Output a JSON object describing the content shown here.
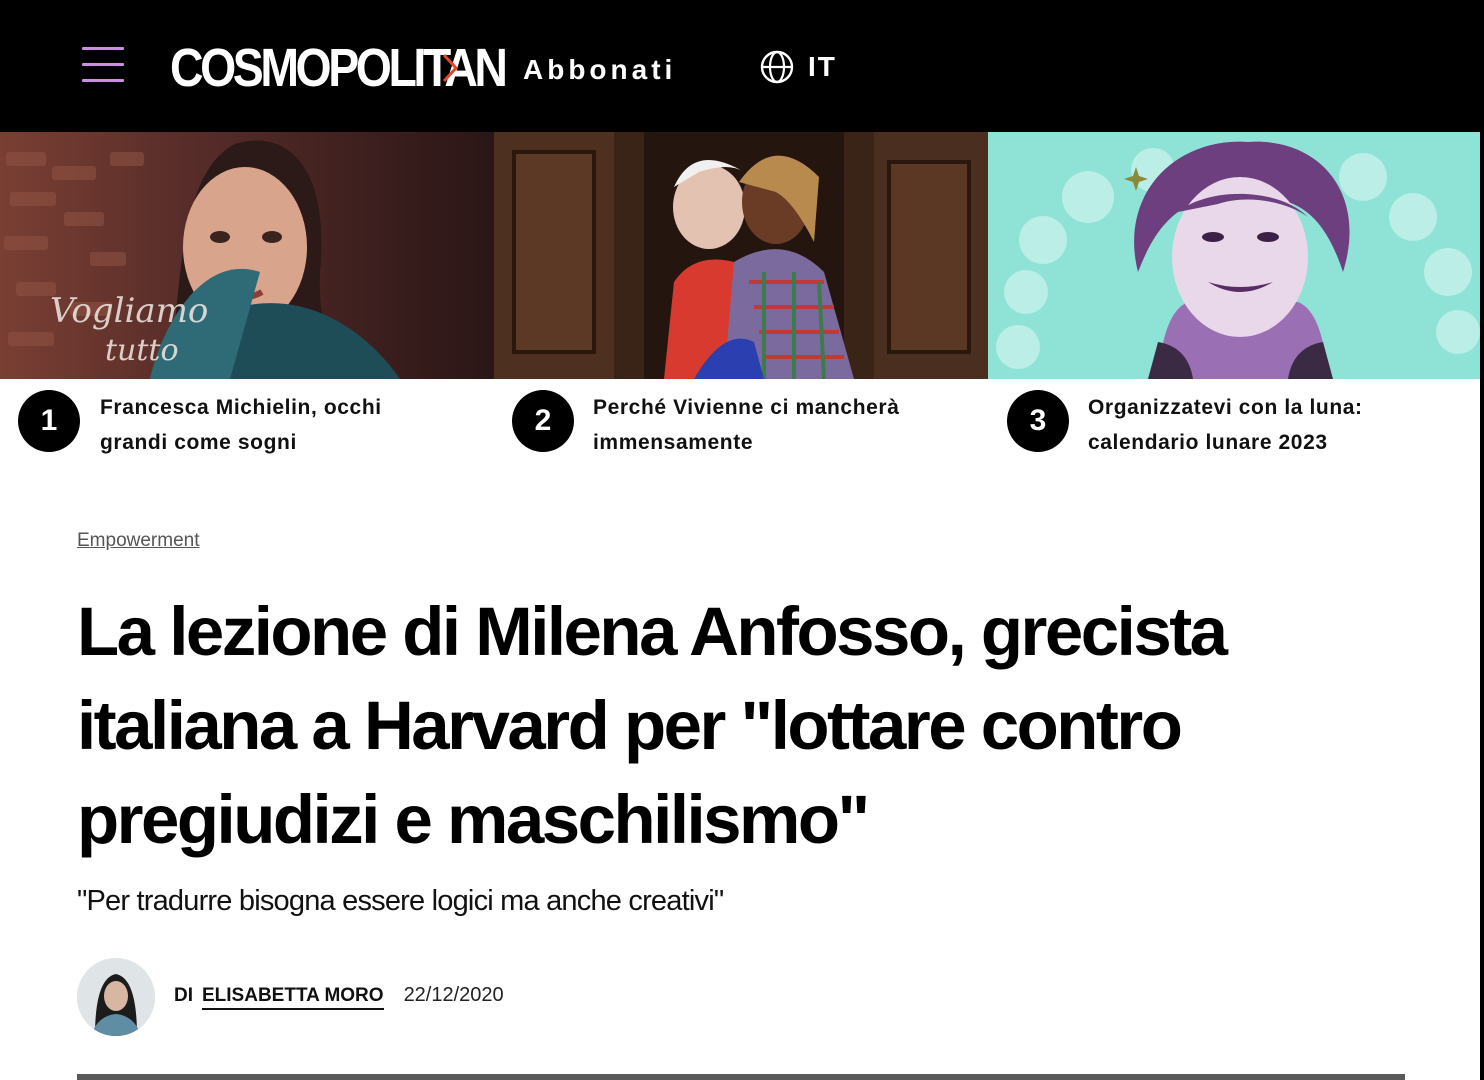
{
  "header": {
    "logo_text": "COSMOPOLITAN",
    "subscribe_label": "Abbonati",
    "language_label": "IT",
    "colors": {
      "background": "#000000",
      "menu_icon": "#c98fe6",
      "logo_arrow": "#e2462f"
    }
  },
  "trending": [
    {
      "number": "1",
      "title_line1": "Francesca Michielin, occhi",
      "title_line2": "grandi come sogni",
      "image_text": "Vogliamo tutto"
    },
    {
      "number": "2",
      "title_line1": "Perché Vivienne ci mancherà",
      "title_line2": "immensamente"
    },
    {
      "number": "3",
      "title_line1": "Organizzatevi con la luna:",
      "title_line2": "calendario lunare 2023"
    }
  ],
  "article": {
    "category": "Empowerment",
    "headline": "La lezione di Milena Anfosso, grecista italiana a Harvard per \"lottare contro pregiudizi e maschilismo\"",
    "dek": "\"Per tradurre bisogna essere logici ma anche creativi\"",
    "byline_prefix": "DI",
    "author": "ELISABETTA MORO",
    "date": "22/12/2020"
  }
}
